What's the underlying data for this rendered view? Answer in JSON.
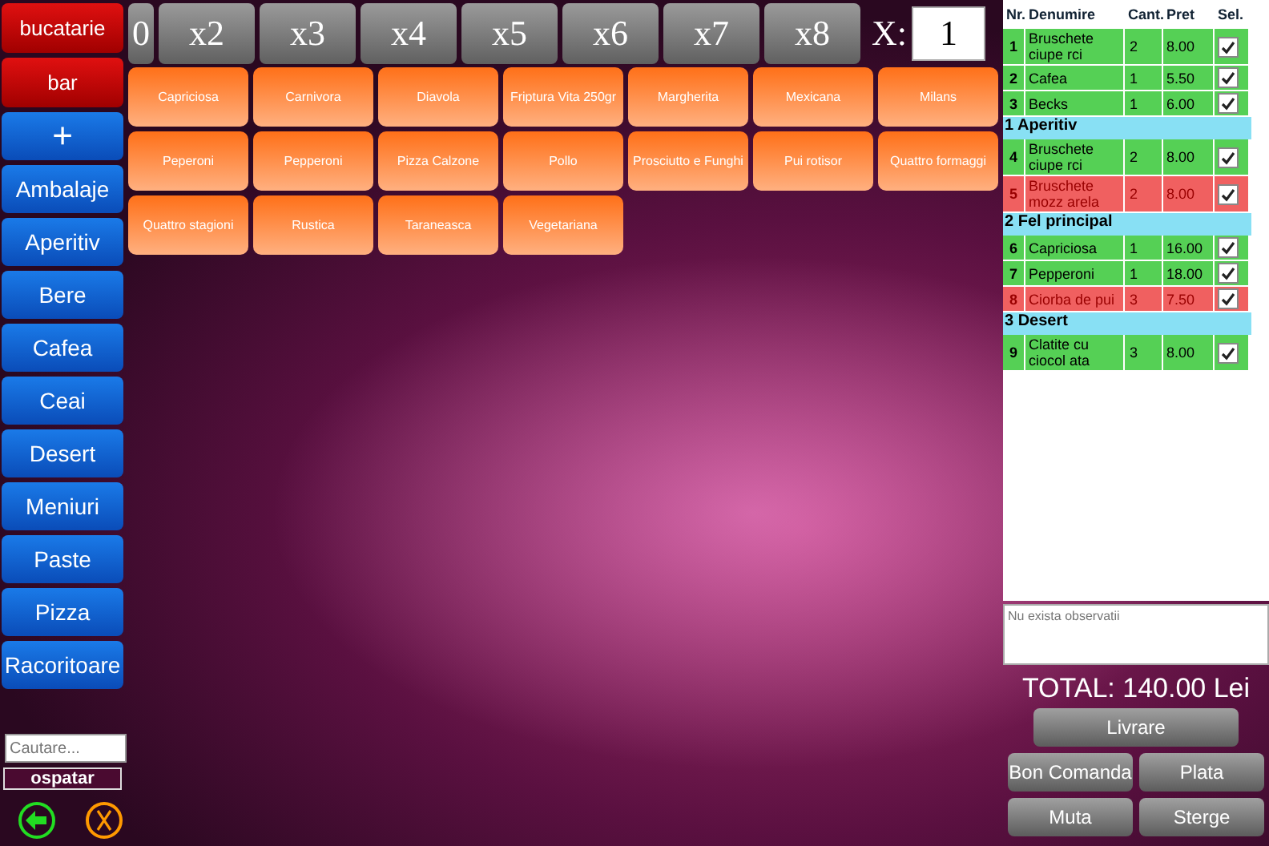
{
  "printers": [
    {
      "label": "bucatarie"
    },
    {
      "label": "bar"
    }
  ],
  "add_button": {
    "label": "+"
  },
  "categories": [
    {
      "label": "Ambalaje"
    },
    {
      "label": "Aperitiv"
    },
    {
      "label": "Bere"
    },
    {
      "label": "Cafea"
    },
    {
      "label": "Ceai"
    },
    {
      "label": "Desert"
    },
    {
      "label": "Meniuri"
    },
    {
      "label": "Paste"
    },
    {
      "label": "Pizza"
    },
    {
      "label": "Racoritoare"
    }
  ],
  "search": {
    "placeholder": "Cautare..."
  },
  "waiter": {
    "label": "ospatar"
  },
  "multipliers": [
    "0",
    "x2",
    "x3",
    "x4",
    "x5",
    "x6",
    "x7",
    "x8"
  ],
  "quantity": {
    "label": "X:",
    "value": "1"
  },
  "products": [
    "Capriciosa",
    "Carnivora",
    "Diavola",
    "Friptura Vita 250gr",
    "Margherita",
    "Mexicana",
    "Milans",
    "Peperoni",
    "Pepperoni",
    "Pizza Calzone",
    "Pollo",
    "Prosciutto e Funghi",
    "Pui rotisor",
    "Quattro formaggi",
    "Quattro stagioni",
    "Rustica",
    "Taraneasca",
    "Vegetariana"
  ],
  "order": {
    "columns": [
      "Nr.",
      "Denumire",
      "Cant.",
      "Pret",
      "Sel."
    ],
    "rows": [
      {
        "kind": "item",
        "nr": "1",
        "name": "Bruschete ciupe rci",
        "qty": "2",
        "price": "8.00",
        "checked": true,
        "color": "#55d055"
      },
      {
        "kind": "item",
        "nr": "2",
        "name": "Cafea",
        "qty": "1",
        "price": "5.50",
        "checked": true,
        "color": "#55d055"
      },
      {
        "kind": "item",
        "nr": "3",
        "name": "Becks",
        "qty": "1",
        "price": "6.00",
        "checked": true,
        "color": "#55d055"
      },
      {
        "kind": "group",
        "label": "1 Aperitiv"
      },
      {
        "kind": "item",
        "nr": "4",
        "name": "Bruschete ciupe rci",
        "qty": "2",
        "price": "8.00",
        "checked": true,
        "color": "#55d055"
      },
      {
        "kind": "item",
        "nr": "5",
        "name": "Bruschete mozz arela",
        "qty": "2",
        "price": "8.00",
        "checked": true,
        "color": "#f06060"
      },
      {
        "kind": "group",
        "label": "2 Fel principal"
      },
      {
        "kind": "item",
        "nr": "6",
        "name": "Capriciosa",
        "qty": "1",
        "price": "16.00",
        "checked": true,
        "color": "#55d055"
      },
      {
        "kind": "item",
        "nr": "7",
        "name": "Pepperoni",
        "qty": "1",
        "price": "18.00",
        "checked": true,
        "color": "#55d055"
      },
      {
        "kind": "item",
        "nr": "8",
        "name": "Ciorba de pui",
        "qty": "3",
        "price": "7.50",
        "checked": true,
        "color": "#f06060"
      },
      {
        "kind": "group",
        "label": "3 Desert"
      },
      {
        "kind": "item",
        "nr": "9",
        "name": "Clatite cu ciocol ata",
        "qty": "3",
        "price": "8.00",
        "checked": true,
        "color": "#55d055"
      }
    ]
  },
  "notes": {
    "placeholder": "Nu exista observatii"
  },
  "total": "TOTAL: 140.00 Lei",
  "actions": [
    {
      "label": "Livrare",
      "wide": true
    },
    {
      "label": "Bon Comanda",
      "wide": false
    },
    {
      "label": "Plata",
      "wide": false
    },
    {
      "label": "Muta",
      "wide": false
    },
    {
      "label": "Sterge",
      "wide": false
    }
  ]
}
